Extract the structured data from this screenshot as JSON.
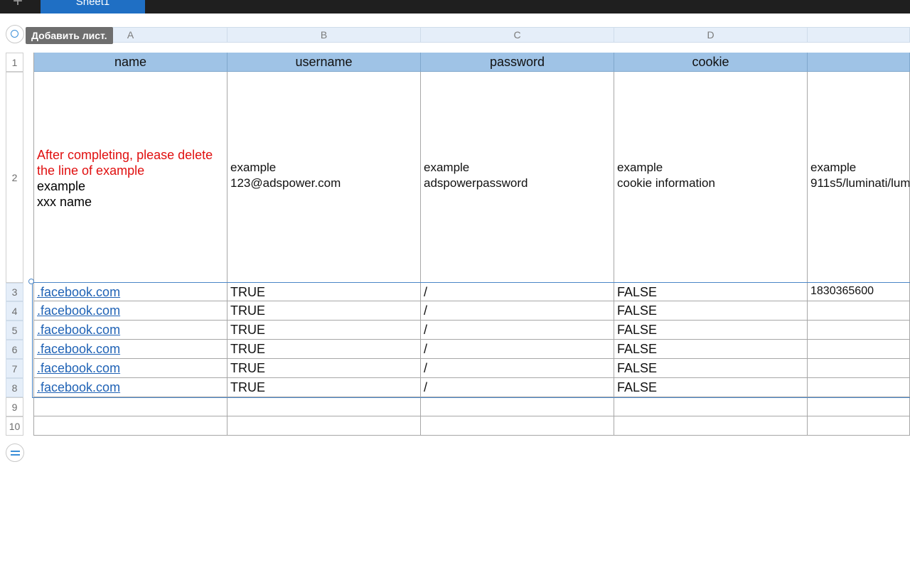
{
  "tabs": {
    "active_sheet": "Sheet1",
    "add_icon": "+"
  },
  "tooltip": "Добавить лист.",
  "columns": [
    "A",
    "B",
    "C",
    "D"
  ],
  "rows": [
    "1",
    "2",
    "3",
    "4",
    "5",
    "6",
    "7",
    "8",
    "9",
    "10"
  ],
  "header": {
    "a": "name",
    "b": "username",
    "c": "password",
    "d": "cookie",
    "e": ""
  },
  "row2": {
    "a_red": "After completing, please delete the line of example",
    "a_line1": "example",
    "a_line2": "xxx name",
    "b_line1": "example",
    "b_line2": "123@adspower.com",
    "c_line1": "example",
    "c_line2": "adspowerpassword",
    "d_line1": "example",
    "d_line2": "cookie information",
    "e_line1": "example",
    "e_line2": "911s5/luminati/lum"
  },
  "data_rows": [
    {
      "a": ".facebook.com",
      "b": "TRUE",
      "c": "/",
      "d": "FALSE",
      "e": "1830365600"
    },
    {
      "a": ".facebook.com",
      "b": "TRUE",
      "c": "/",
      "d": "FALSE",
      "e": ""
    },
    {
      "a": ".facebook.com",
      "b": "TRUE",
      "c": "/",
      "d": "FALSE",
      "e": ""
    },
    {
      "a": ".facebook.com",
      "b": "TRUE",
      "c": "/",
      "d": "FALSE",
      "e": ""
    },
    {
      "a": ".facebook.com",
      "b": "TRUE",
      "c": "/",
      "d": "FALSE",
      "e": ""
    },
    {
      "a": ".facebook.com",
      "b": "TRUE",
      "c": "/",
      "d": "FALSE",
      "e": ""
    }
  ],
  "icons": {
    "select_all": "circle-icon",
    "add_row": "equals-icon",
    "add_sheet": "plus-icon"
  },
  "colors": {
    "header_fill": "#9fc3e6",
    "link": "#1f62b5",
    "warning_text": "#e00f0f",
    "active_tab": "#1f6fc4"
  }
}
